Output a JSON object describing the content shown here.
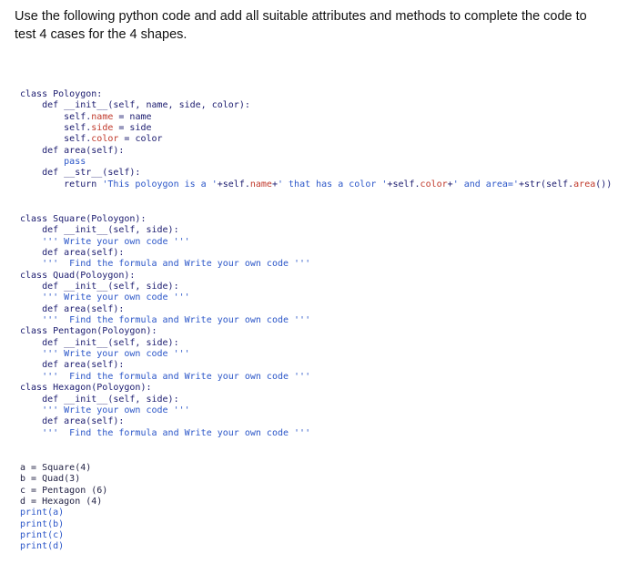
{
  "question": {
    "line1": "Use the following python code and add all suitable attributes and methods to complete the code to",
    "line2": "test 4 cases for the 4 shapes."
  },
  "block1": [
    "class Poloygon:",
    "    def __init__(self, name, side, color):",
    "        self.name = name",
    "        self.side = side",
    "        self.color = color",
    "    def area(self):",
    "        pass",
    "    def __str__(self):",
    "        return 'This poloygon is a '+self.name+' that has a color '+self.color+' and area='+str(self.area())"
  ],
  "block2": [
    "class Square(Poloygon):",
    "    def __init__(self, side):",
    "    ''' Write your own code '''",
    "    def area(self):",
    "    '''  Find the formula and Write your own code '''",
    "class Quad(Poloygon):",
    "    def __init__(self, side):",
    "    ''' Write your own code '''",
    "    def area(self):",
    "    '''  Find the formula and Write your own code '''",
    "class Pentagon(Poloygon):",
    "    def __init__(self, side):",
    "    ''' Write your own code '''",
    "    def area(self):",
    "    '''  Find the formula and Write your own code '''",
    "class Hexagon(Poloygon):",
    "    def __init__(self, side):",
    "    ''' Write your own code '''",
    "    def area(self):",
    "    '''  Find the formula and Write your own code '''"
  ],
  "block3": [
    "a = Square(4)",
    "b = Quad(3)",
    "c = Pentagon (6)",
    "d = Hexagon (4)",
    "print(a)",
    "print(b)",
    "print(c)",
    "print(d)"
  ]
}
